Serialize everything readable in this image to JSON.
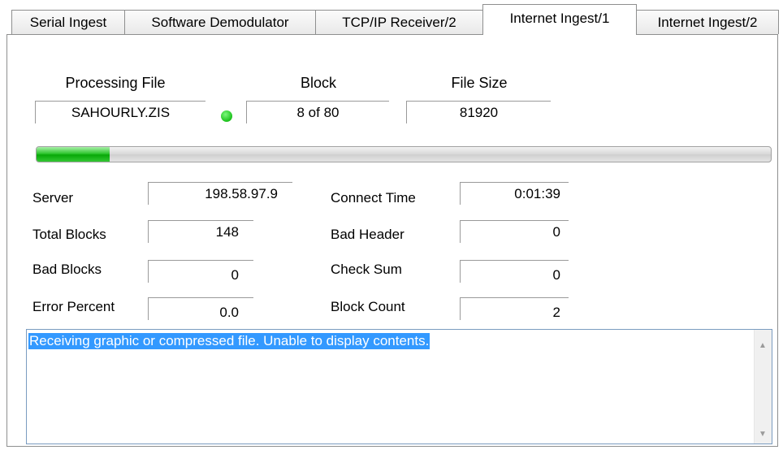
{
  "tabs": [
    {
      "label": "Serial Ingest"
    },
    {
      "label": "Software Demodulator"
    },
    {
      "label": "TCP/IP Receiver/2"
    },
    {
      "label": "Internet Ingest/1"
    },
    {
      "label": "Internet Ingest/2"
    }
  ],
  "active_tab": "Internet Ingest/1",
  "header": {
    "processing_file_label": "Processing File",
    "processing_file": "SAHOURLY.ZIS",
    "block_label": "Block",
    "block": "8 of 80",
    "file_size_label": "File Size",
    "file_size": "81920",
    "status_color": "#1cc11c"
  },
  "progress": {
    "fraction": 0.1
  },
  "stats": {
    "server_label": "Server",
    "server": "198.58.97.9",
    "total_blocks_label": "Total Blocks",
    "total_blocks": "148",
    "bad_blocks_label": "Bad Blocks",
    "bad_blocks": "0",
    "error_percent_label": "Error Percent",
    "error_percent": "0.0",
    "connect_time_label": "Connect Time",
    "connect_time": "0:01:39",
    "bad_header_label": "Bad Header",
    "bad_header": "0",
    "check_sum_label": "Check Sum",
    "check_sum": "0",
    "block_count_label": "Block Count",
    "block_count": "2"
  },
  "log": {
    "text": "Receiving graphic or compressed file. Unable to display contents."
  },
  "icons": {
    "scroll_up": "chevron-up-icon",
    "scroll_down": "chevron-down-icon"
  }
}
